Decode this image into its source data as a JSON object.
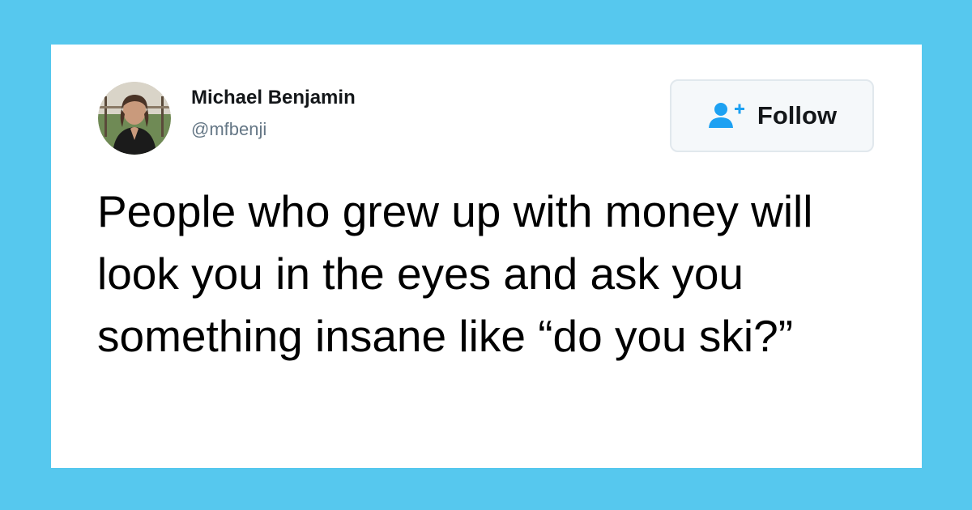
{
  "tweet": {
    "author": {
      "name": "Michael Benjamin",
      "handle": "@mfbenji",
      "avatar_icon": "avatar-photo-icon"
    },
    "follow_button": {
      "label": "Follow",
      "icon": "add-user-icon",
      "icon_color": "#1da1f2"
    },
    "text": "People who grew up with money will look you in the eyes and ask you something insane like “do you ski?”"
  },
  "colors": {
    "background": "#56c8ee",
    "card": "#ffffff",
    "accent": "#1da1f2"
  }
}
